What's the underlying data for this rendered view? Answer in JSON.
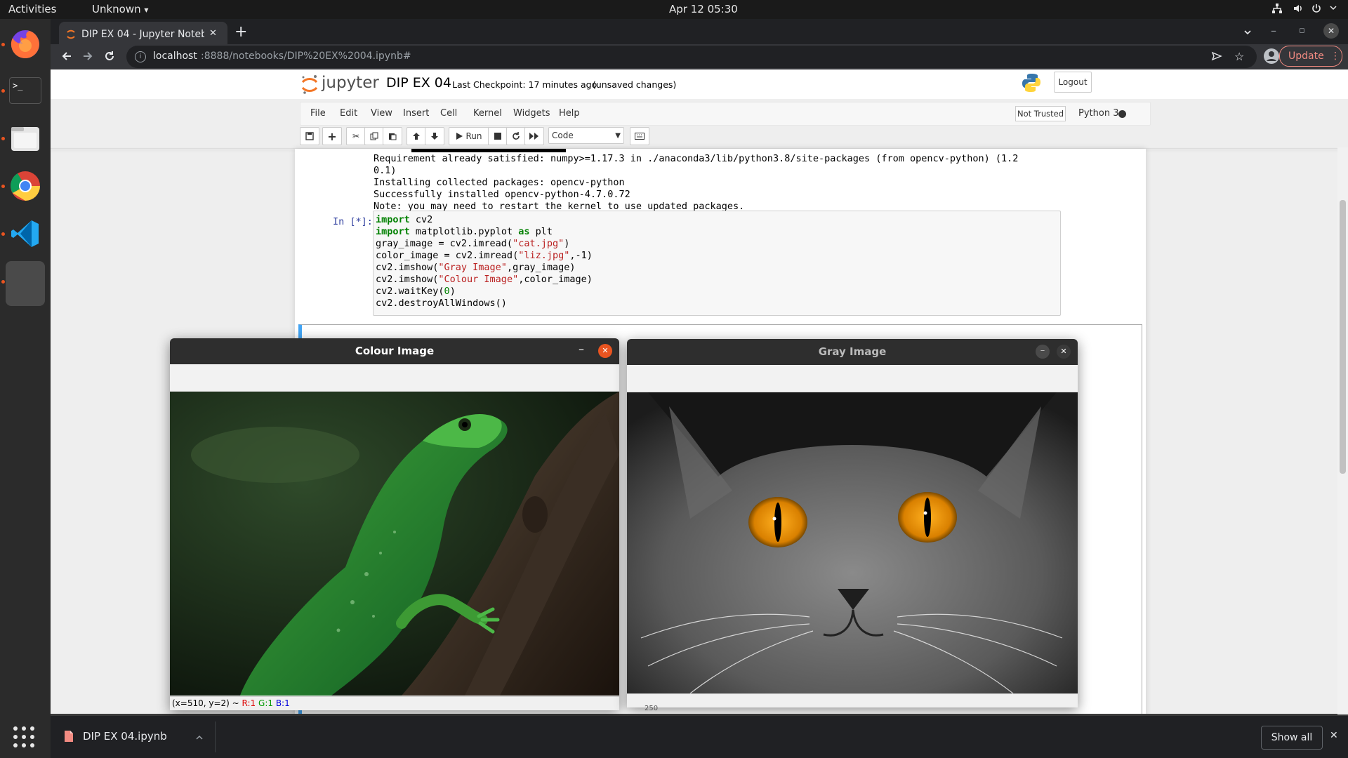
{
  "topbar": {
    "activities": "Activities",
    "app_menu": "Unknown",
    "app_menu_caret": "▾",
    "datetime": "Apr 12  05:30",
    "tray_icons": [
      "network-icon",
      "volume-icon",
      "power-icon",
      "chevron-down-icon"
    ]
  },
  "dock": {
    "apps": [
      "firefox-icon",
      "terminal-icon",
      "files-icon",
      "chrome-icon",
      "vscode-icon",
      "active-app-icon"
    ]
  },
  "browser": {
    "tab_title": "DIP EX 04 - Jupyter Notebo",
    "tab_close": "✕",
    "new_tab": "+",
    "url_host": "localhost",
    "url_path": ":8888/notebooks/DIP%20EX%2004.ipynb#",
    "update_label": "Update",
    "menu_icon": "⋮"
  },
  "jupyter": {
    "logo_text": "jupyter",
    "notebook_name": "DIP EX 04",
    "checkpoint": "Last Checkpoint: 17 minutes ago",
    "unsaved": "(unsaved changes)",
    "logout": "Logout",
    "menus": [
      "File",
      "Edit",
      "View",
      "Insert",
      "Cell",
      "Kernel",
      "Widgets",
      "Help"
    ],
    "trust": "Not Trusted",
    "kernel": "Python 3",
    "run_label": "Run",
    "cell_type": "Code"
  },
  "output_lines": [
    "Requirement already satisfied: numpy>=1.17.3 in ./anaconda3/lib/python3.8/site-packages (from opencv-python) (1.2",
    "0.1)",
    "Installing collected packages: opencv-python",
    "Successfully installed opencv-python-4.7.0.72",
    "Note: you may need to restart the kernel to use updated packages."
  ],
  "cell": {
    "prompt": "In [*]:",
    "code_parts": {
      "l1_kw": "import",
      "l1_rest": " cv2",
      "l2_kw": "import",
      "l2_mid": " matplotlib.pyplot ",
      "l2_kw2": "as",
      "l2_rest": " plt",
      "l3_a": "gray_image = cv2.imread(",
      "l3_s": "\"cat.jpg\"",
      "l3_b": ")",
      "l4_a": "color_image = cv2.imread(",
      "l4_s": "\"liz.jpg\"",
      "l4_b": ",-1)",
      "l5_a": "cv2.imshow(",
      "l5_s": "\"Gray Image\"",
      "l5_b": ",gray_image)",
      "l6_a": "cv2.imshow(",
      "l6_s": "\"Colour Image\"",
      "l6_b": ",color_image)",
      "l7_a": "cv2.waitKey(",
      "l7_n": "0",
      "l7_b": ")",
      "l8": "cv2.destroyAllWindows()"
    }
  },
  "colour_window": {
    "title": "Colour Image",
    "minimize": "–",
    "close": "✕",
    "status_pos": "(x=510, y=2) ~ ",
    "status_r": "R:1",
    "status_g": "G:1",
    "status_b": "B:1"
  },
  "gray_window": {
    "title": "Gray Image",
    "minimize": "–",
    "close": "✕"
  },
  "partial_axis_label": "250",
  "downloads": {
    "file_name": "DIP EX 04.ipynb",
    "show_all": "Show all",
    "close": "✕"
  },
  "colors": {
    "ubuntu_orange": "#e95420",
    "jupyter_orange": "#f37626",
    "chrome_dark": "#202124"
  }
}
